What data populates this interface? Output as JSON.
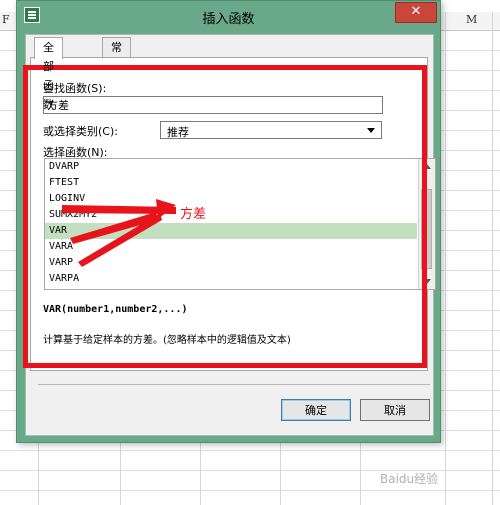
{
  "sheet": {
    "col_f": "F",
    "col_m": "M"
  },
  "dialog": {
    "title": "插入函数",
    "close_glyph": "✕",
    "tabs": [
      "全部函数",
      "常用公式"
    ],
    "search_label": "查找函数(S):",
    "search_value": "方差",
    "category_label": "或选择类别(C):",
    "category_value": "推荐",
    "list_label": "选择函数(N):",
    "functions": [
      "DVARP",
      "FTEST",
      "LOGINV",
      "SUMX2MY2",
      "VAR",
      "VARA",
      "VARP",
      "VARPA"
    ],
    "selected_function": "VAR",
    "signature": "VAR(number1,number2,...)",
    "description": "计算基于给定样本的方差。(忽略样本中的逻辑值及文本)",
    "ok_label": "确定",
    "cancel_label": "取消"
  },
  "annotation": {
    "text": "方差",
    "color": "#e8141c"
  },
  "watermark": "Baidu经验",
  "colors": {
    "dialog_frame": "#6aa88a",
    "selection": "#c4dfc0",
    "close_button": "#c9463d"
  }
}
